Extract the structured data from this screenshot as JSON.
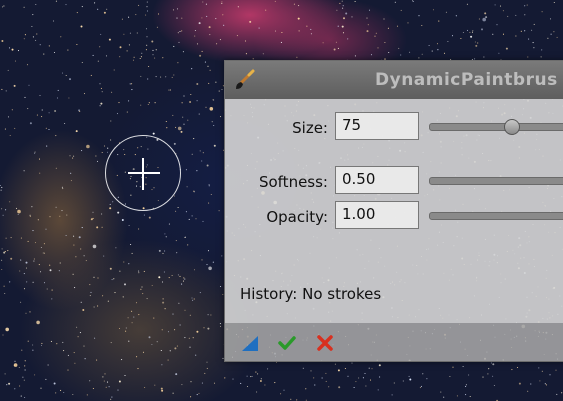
{
  "window": {
    "title": "DynamicPaintbrus"
  },
  "controls": {
    "size": {
      "label": "Size:",
      "value": "75",
      "slider_fraction": 0.55
    },
    "softness": {
      "label": "Softness:",
      "value": "0.50",
      "slider_fraction": 0.5
    },
    "opacity": {
      "label": "Opacity:",
      "value": "1.00",
      "slider_fraction": 1.0
    }
  },
  "history": {
    "text": "History: No strokes"
  },
  "footer": {
    "icons": [
      "new-instance-icon",
      "checkmark-icon",
      "cancel-icon"
    ]
  },
  "colors": {
    "accept": "#2a9a2a",
    "cancel": "#d8301f",
    "instance": "#1f6fc0"
  }
}
